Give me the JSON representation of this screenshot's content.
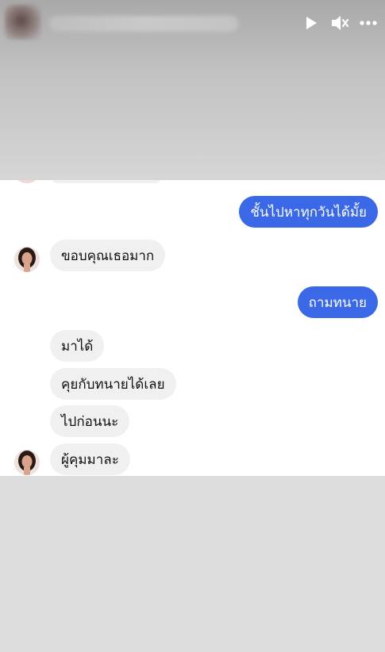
{
  "story_header": {
    "controls": [
      {
        "icon": "play-icon"
      },
      {
        "icon": "muted-speaker-icon"
      },
      {
        "icon": "more-icon"
      }
    ]
  },
  "chat": {
    "messages": [
      {
        "direction": "outgoing",
        "text": "ชั้นไปหาทุกวันได้มั้ย"
      },
      {
        "direction": "incoming",
        "text": "ขอบคุณเธอมาก",
        "avatar": true
      },
      {
        "direction": "outgoing",
        "text": "ถามทนาย"
      },
      {
        "direction": "incoming",
        "text": "มาได้"
      },
      {
        "direction": "incoming",
        "text": "คุยกับทนายได้เลย"
      },
      {
        "direction": "incoming",
        "text": "ไปก่อนนะ"
      },
      {
        "direction": "incoming",
        "text": "ผู้คุมมาละ",
        "avatar": true
      }
    ]
  },
  "colors": {
    "outgoing_bubble": "#3b68e6",
    "incoming_bubble": "#f0f0f0",
    "background_gray": "#dcdcdc"
  }
}
